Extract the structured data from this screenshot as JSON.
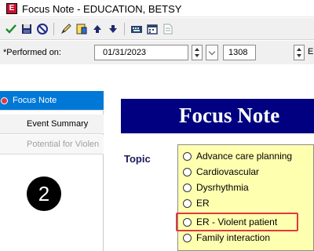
{
  "window": {
    "icon_letter": "E",
    "title": "Focus Note - EDUCATION, BETSY"
  },
  "toolbar": {
    "icons": [
      "checkmark-icon",
      "save-icon",
      "cancel-icon",
      "edit-pencil-icon",
      "document-icon",
      "arrow-up-icon",
      "arrow-down-icon",
      "keyboard-icon",
      "calendar-icon",
      "print-preview-icon"
    ]
  },
  "form": {
    "performed_on_label": "*Performed on:",
    "date_value": "01/31/2023",
    "time_value": "1308",
    "truncated_label": "E"
  },
  "nav": {
    "items": [
      {
        "label": "Focus Note",
        "state": "active"
      },
      {
        "label": "Event Summary",
        "state": "normal"
      },
      {
        "label": "Potential for Violen",
        "state": "disabled"
      }
    ]
  },
  "main": {
    "banner_title": "Focus Note",
    "topic_label": "Topic",
    "topic_options": [
      "Advance care planning",
      "Cardiovascular",
      "Dysrhythmia",
      "ER",
      "ER - Violent patient",
      "Family interaction"
    ],
    "highlighted_option": "ER - Violent patient"
  },
  "annotation": {
    "step_number": "2"
  },
  "colors": {
    "banner": "#000080",
    "list_background": "#ffffb0",
    "nav_active": "#0078d7",
    "highlight_border": "#e0393e",
    "app_icon": "#c8102e"
  }
}
